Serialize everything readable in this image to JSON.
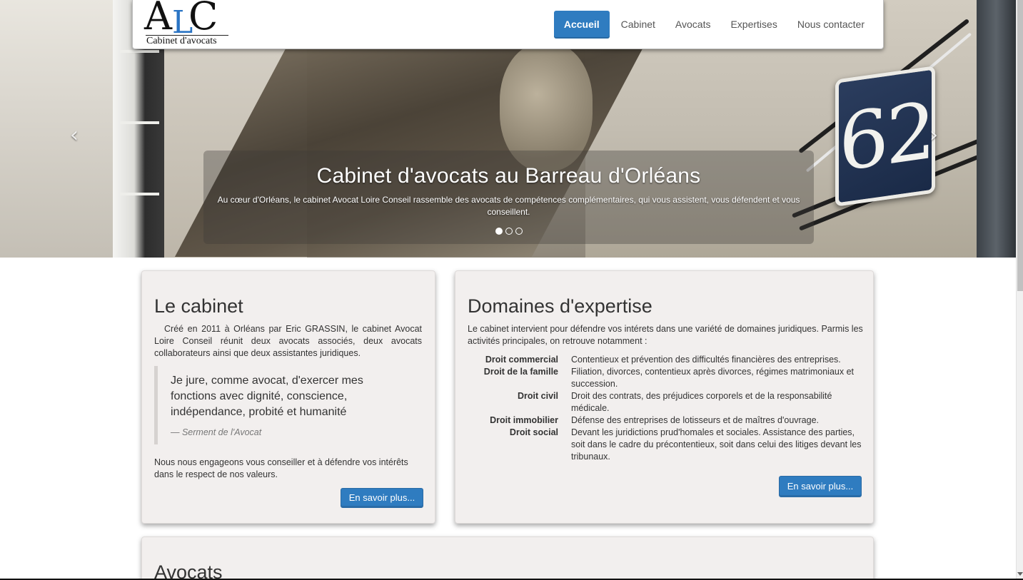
{
  "brand": {
    "logo_a": "A",
    "logo_l": "L",
    "logo_c": "C",
    "tagline": "Cabinet d'avocats"
  },
  "nav": {
    "items": [
      {
        "label": "Accueil",
        "active": true
      },
      {
        "label": "Cabinet",
        "active": false
      },
      {
        "label": "Avocats",
        "active": false
      },
      {
        "label": "Expertises",
        "active": false
      },
      {
        "label": "Nous contacter",
        "active": false
      }
    ]
  },
  "carousel": {
    "title": "Cabinet d'avocats au Barreau d'Orléans",
    "subtitle": "Au cœur d'Orléans, le cabinet Avocat Loire Conseil rassemble des avocats de compétences complémentaires, qui vous assistent, vous défendent et vous conseillent.",
    "plaque_number": "62",
    "prev_arrow": "‹",
    "next_arrow": "›",
    "slides_count": 3,
    "active_slide": 1
  },
  "cabinet": {
    "title": "Le cabinet",
    "intro": "Créé en 2011 à Orléans par Eric GRASSIN, le cabinet Avocat Loire Conseil réunit deux avocats associés, deux avocats collaborateurs ainsi que deux assistantes juridiques.",
    "quote": "Je jure, comme avocat, d'exercer mes fonctions avec dignité, conscience, indépendance, probité et humanité",
    "quote_source": "— Serment de l'Avocat",
    "outro": "Nous nous engageons vous conseiller et à défendre vos intérêts dans le respect de nos valeurs.",
    "button": "En savoir plus..."
  },
  "expertise": {
    "title": "Domaines d'expertise",
    "intro": "Le cabinet intervient pour défendre vos intérets dans une variété de domaines juridiques. Parmis les activités principales, on retrouve notamment :",
    "items": [
      {
        "term": "Droit commercial",
        "desc": "Contentieux et prévention des difficultés financières des entreprises."
      },
      {
        "term": "Droit de la famille",
        "desc": "Filiation, divorces, contentieux après divorces, régimes matrimoniaux et succession."
      },
      {
        "term": "Droit civil",
        "desc": "Droit des contrats, des préjudices corporels et de la responsabilité médicale."
      },
      {
        "term": "Droit immobilier",
        "desc": "Défense des entreprises de lotisseurs et de maîtres d'ouvrage."
      },
      {
        "term": "Droit social",
        "desc": "Devant les juridictions prud'homales et sociales. Assistance des parties, soit dans le cadre du précontentieux, soit dans celui des litiges devant les tribunaux."
      }
    ],
    "button": "En savoir plus..."
  },
  "avocats": {
    "title": "Avocats"
  },
  "colors": {
    "accent": "#2f7cc0",
    "card_bg": "#f2efee",
    "plaque": "#1a2a47"
  }
}
